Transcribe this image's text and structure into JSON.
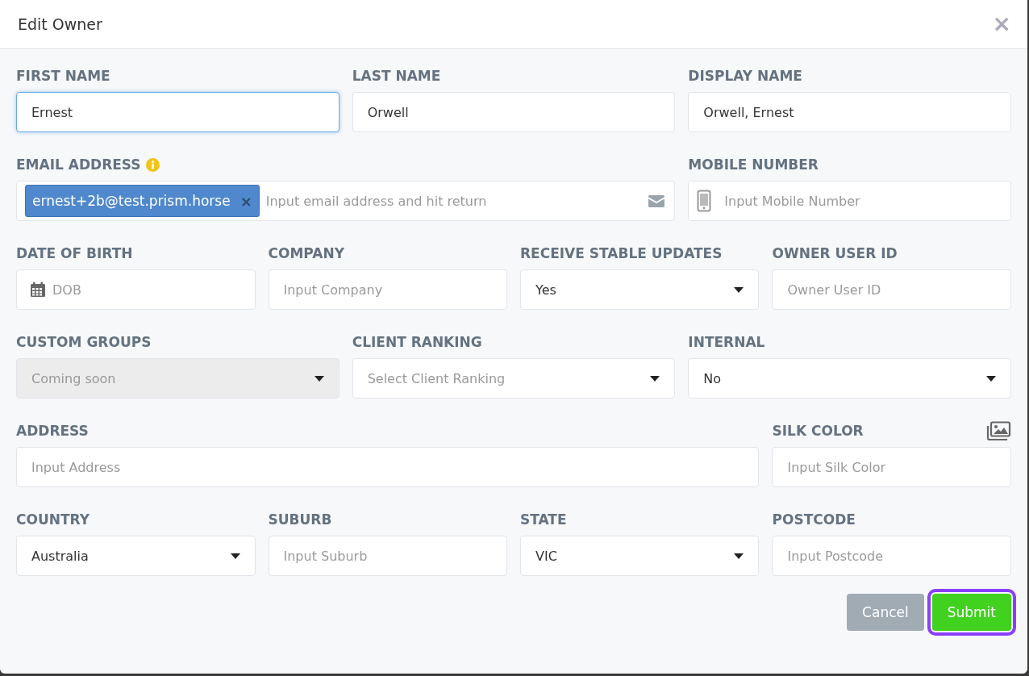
{
  "dialog": {
    "title": "Edit Owner",
    "close": "×"
  },
  "rows": [
    [
      {
        "label": "FIRST NAME",
        "kind": "text",
        "value": "Ernest",
        "focused": true
      },
      {
        "label": "LAST NAME",
        "kind": "text",
        "value": "Orwell",
        "focused": false
      },
      {
        "label": "DISPLAY NAME",
        "kind": "text",
        "value": "Orwell, Ernest",
        "focused": false
      }
    ],
    [
      {
        "label": "EMAIL ADDRESS",
        "kind": "tags",
        "info": true,
        "tags": [
          {
            "text": "ernest+2b@test.prism.horse",
            "remove": "×"
          }
        ],
        "placeholder": "Input email address and hit return"
      },
      {
        "label": "MOBILE NUMBER",
        "kind": "phone",
        "placeholder": "Input Mobile Number"
      }
    ],
    [
      {
        "label": "DATE OF BIRTH",
        "kind": "date",
        "placeholder": "DOB"
      },
      {
        "label": "COMPANY",
        "kind": "text",
        "placeholder": "Input Company",
        "focused": false
      },
      {
        "label": "RECEIVE STABLE UPDATES",
        "kind": "select",
        "value": "Yes",
        "disabled": false
      },
      {
        "label": "OWNER USER ID",
        "kind": "text",
        "placeholder": "Owner User ID",
        "focused": false
      }
    ],
    [
      {
        "label": "CUSTOM GROUPS",
        "kind": "select",
        "value": "Coming soon",
        "disabled": true
      },
      {
        "label": "CLIENT RANKING",
        "kind": "select",
        "placeholder": "Select Client Ranking",
        "disabled": false
      },
      {
        "label": "INTERNAL",
        "kind": "select",
        "value": "No",
        "disabled": false
      }
    ],
    [
      {
        "label": "ADDRESS",
        "kind": "text",
        "placeholder": "Input Address",
        "focused": false
      },
      {
        "label": "SILK COLOR",
        "kind": "text",
        "placeholder": "Input Silk Color",
        "focused": false,
        "image_button": true
      }
    ],
    [
      {
        "label": "COUNTRY",
        "kind": "select",
        "value": "Australia",
        "disabled": false
      },
      {
        "label": "SUBURB",
        "kind": "text",
        "placeholder": "Input Suburb",
        "focused": false
      },
      {
        "label": "STATE",
        "kind": "select",
        "value": "VIC",
        "disabled": false
      },
      {
        "label": "POSTCODE",
        "kind": "text",
        "placeholder": "Input Postcode",
        "focused": false
      }
    ]
  ],
  "buttons": [
    {
      "label": "Cancel",
      "kind": "secondary",
      "focused": false
    },
    {
      "label": "Submit",
      "kind": "primary",
      "focused": true
    }
  ]
}
